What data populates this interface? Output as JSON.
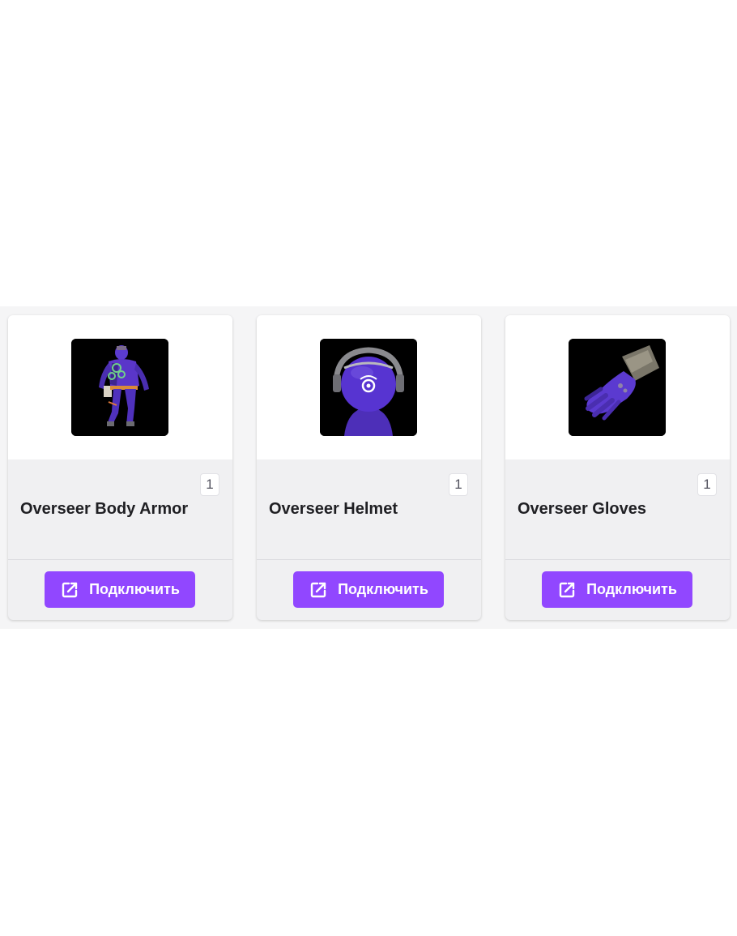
{
  "theme": {
    "accent": "#9147ff",
    "card_background": "#f0f0f2",
    "page_band": "#f5f5f6"
  },
  "cards": [
    {
      "title": "Overseer Body Armor",
      "quantity": "1",
      "button_label": "Подключить",
      "button_icon": "external-link-icon",
      "image": "overseer-body-armor-image"
    },
    {
      "title": "Overseer Helmet",
      "quantity": "1",
      "button_label": "Подключить",
      "button_icon": "external-link-icon",
      "image": "overseer-helmet-image"
    },
    {
      "title": "Overseer Gloves",
      "quantity": "1",
      "button_label": "Подключить",
      "button_icon": "external-link-icon",
      "image": "overseer-gloves-image"
    }
  ]
}
